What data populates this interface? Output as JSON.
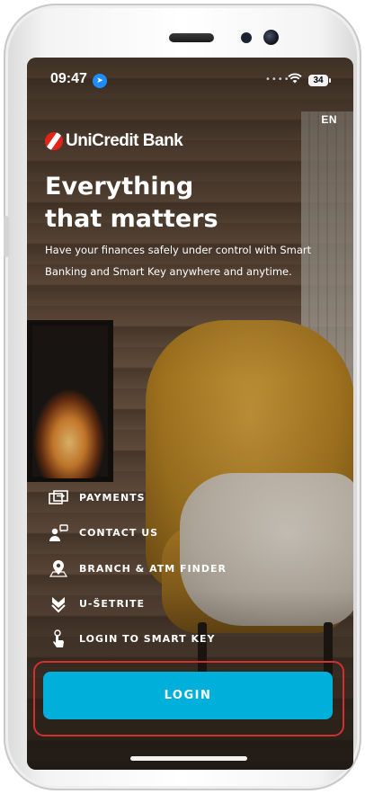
{
  "status_bar": {
    "time": "09:47",
    "battery": "34",
    "icons": [
      "location-arrow-icon",
      "signal-dots-icon",
      "wifi-icon",
      "battery-icon"
    ]
  },
  "language": "EN",
  "brand": {
    "name": "UniCredit Bank",
    "accent_color": "#e2231a"
  },
  "hero": {
    "headline_line1": "Everything",
    "headline_line2": "that matters",
    "subtitle": "Have your finances safely under control with Smart Banking and Smart Key anywhere and anytime."
  },
  "menu": {
    "items": [
      {
        "label": "PAYMENTS",
        "icon": "payments-icon"
      },
      {
        "label": "CONTACT US",
        "icon": "contact-icon"
      },
      {
        "label": "BRANCH & ATM FINDER",
        "icon": "map-pin-icon"
      },
      {
        "label": "U-ŠETRITE",
        "icon": "u-setrite-icon"
      },
      {
        "label": "LOGIN TO SMART KEY",
        "icon": "smart-key-icon"
      }
    ]
  },
  "login": {
    "label": "LOGIN",
    "color": "#00b0db",
    "highlight_color": "#d32f2f"
  }
}
